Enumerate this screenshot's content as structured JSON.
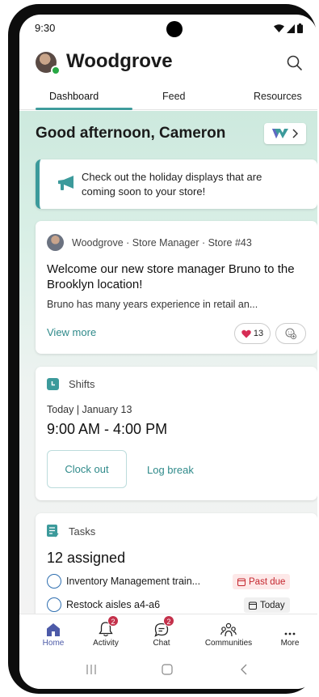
{
  "status_bar": {
    "time": "9:30"
  },
  "header": {
    "title": "Woodgrove"
  },
  "tabs": [
    {
      "label": "Dashboard",
      "active": true
    },
    {
      "label": "Feed",
      "active": false
    },
    {
      "label": "Resources",
      "active": false
    }
  ],
  "greeting": "Good afternoon, Cameron",
  "announcement": {
    "text": "Check out the holiday displays that are coming soon to your store!"
  },
  "post": {
    "author": "Woodgrove · Store Manager · Store #43",
    "title": "Welcome our new store manager Bruno to the Brooklyn location!",
    "body": "Bruno has many years experience in retail an...",
    "view_more": "View more",
    "heart_count": "13"
  },
  "shifts": {
    "heading": "Shifts",
    "date": "Today | January 13",
    "time_range": "9:00 AM - 4:00 PM",
    "clock_out": "Clock out",
    "log_break": "Log break"
  },
  "tasks": {
    "heading": "Tasks",
    "count": "12 assigned",
    "items": [
      {
        "label": "Inventory Management train...",
        "badge": "Past due"
      },
      {
        "label": "Restock aisles a4-a6",
        "badge": "Today"
      }
    ]
  },
  "bottom_nav": [
    {
      "label": "Home",
      "active": true
    },
    {
      "label": "Activity",
      "badge": "2"
    },
    {
      "label": "Chat",
      "badge": "2"
    },
    {
      "label": "Communities"
    },
    {
      "label": "More"
    }
  ],
  "colors": {
    "accent": "#3c9a9b",
    "active_nav": "#4c5aa8",
    "notification": "#c4314b",
    "past_due": "#c4262e"
  }
}
